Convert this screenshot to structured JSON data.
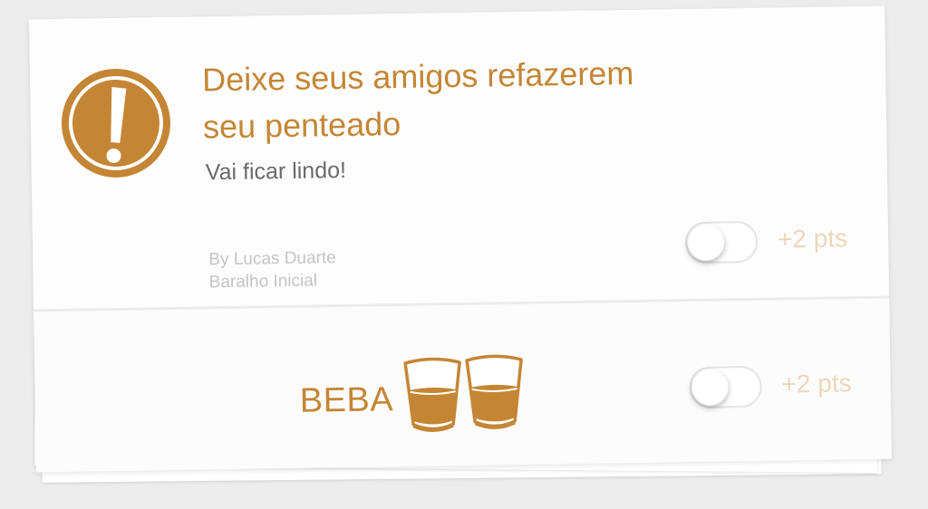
{
  "card": {
    "title_line1": "Deixe seus amigos refazerem",
    "title_line2": "seu penteado",
    "subtitle": "Vai ficar lindo!",
    "author": "By Lucas Duarte",
    "deck": "Baralho Inicial",
    "points_label": "+2 pts",
    "toggle_on": false,
    "icon": "exclamation-circle-icon"
  },
  "drink": {
    "label": "BEBA",
    "points_label": "+2 pts",
    "toggle_on": false,
    "icon": "shot-glasses-icon"
  },
  "colors": {
    "accent": "#c48635",
    "points": "#ecd7bb",
    "subtitle": "#6a6a6a",
    "meta": "#c4c4c4"
  }
}
